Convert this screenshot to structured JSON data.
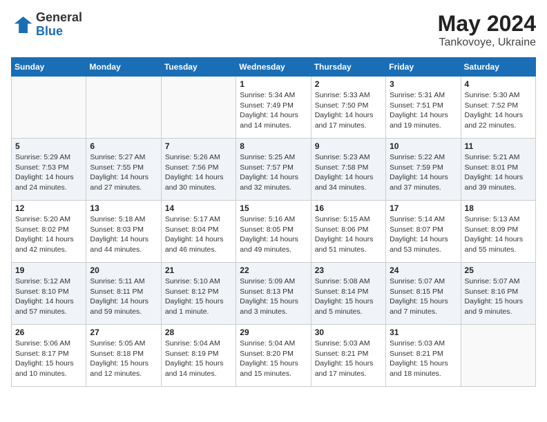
{
  "header": {
    "logo": {
      "line1": "General",
      "line2": "Blue"
    },
    "title": "May 2024",
    "location": "Tankovoye, Ukraine"
  },
  "weekdays": [
    "Sunday",
    "Monday",
    "Tuesday",
    "Wednesday",
    "Thursday",
    "Friday",
    "Saturday"
  ],
  "weeks": [
    [
      {
        "day": "",
        "info": ""
      },
      {
        "day": "",
        "info": ""
      },
      {
        "day": "",
        "info": ""
      },
      {
        "day": "1",
        "info": "Sunrise: 5:34 AM\nSunset: 7:49 PM\nDaylight: 14 hours\nand 14 minutes."
      },
      {
        "day": "2",
        "info": "Sunrise: 5:33 AM\nSunset: 7:50 PM\nDaylight: 14 hours\nand 17 minutes."
      },
      {
        "day": "3",
        "info": "Sunrise: 5:31 AM\nSunset: 7:51 PM\nDaylight: 14 hours\nand 19 minutes."
      },
      {
        "day": "4",
        "info": "Sunrise: 5:30 AM\nSunset: 7:52 PM\nDaylight: 14 hours\nand 22 minutes."
      }
    ],
    [
      {
        "day": "5",
        "info": "Sunrise: 5:29 AM\nSunset: 7:53 PM\nDaylight: 14 hours\nand 24 minutes."
      },
      {
        "day": "6",
        "info": "Sunrise: 5:27 AM\nSunset: 7:55 PM\nDaylight: 14 hours\nand 27 minutes."
      },
      {
        "day": "7",
        "info": "Sunrise: 5:26 AM\nSunset: 7:56 PM\nDaylight: 14 hours\nand 30 minutes."
      },
      {
        "day": "8",
        "info": "Sunrise: 5:25 AM\nSunset: 7:57 PM\nDaylight: 14 hours\nand 32 minutes."
      },
      {
        "day": "9",
        "info": "Sunrise: 5:23 AM\nSunset: 7:58 PM\nDaylight: 14 hours\nand 34 minutes."
      },
      {
        "day": "10",
        "info": "Sunrise: 5:22 AM\nSunset: 7:59 PM\nDaylight: 14 hours\nand 37 minutes."
      },
      {
        "day": "11",
        "info": "Sunrise: 5:21 AM\nSunset: 8:01 PM\nDaylight: 14 hours\nand 39 minutes."
      }
    ],
    [
      {
        "day": "12",
        "info": "Sunrise: 5:20 AM\nSunset: 8:02 PM\nDaylight: 14 hours\nand 42 minutes."
      },
      {
        "day": "13",
        "info": "Sunrise: 5:18 AM\nSunset: 8:03 PM\nDaylight: 14 hours\nand 44 minutes."
      },
      {
        "day": "14",
        "info": "Sunrise: 5:17 AM\nSunset: 8:04 PM\nDaylight: 14 hours\nand 46 minutes."
      },
      {
        "day": "15",
        "info": "Sunrise: 5:16 AM\nSunset: 8:05 PM\nDaylight: 14 hours\nand 49 minutes."
      },
      {
        "day": "16",
        "info": "Sunrise: 5:15 AM\nSunset: 8:06 PM\nDaylight: 14 hours\nand 51 minutes."
      },
      {
        "day": "17",
        "info": "Sunrise: 5:14 AM\nSunset: 8:07 PM\nDaylight: 14 hours\nand 53 minutes."
      },
      {
        "day": "18",
        "info": "Sunrise: 5:13 AM\nSunset: 8:09 PM\nDaylight: 14 hours\nand 55 minutes."
      }
    ],
    [
      {
        "day": "19",
        "info": "Sunrise: 5:12 AM\nSunset: 8:10 PM\nDaylight: 14 hours\nand 57 minutes."
      },
      {
        "day": "20",
        "info": "Sunrise: 5:11 AM\nSunset: 8:11 PM\nDaylight: 14 hours\nand 59 minutes."
      },
      {
        "day": "21",
        "info": "Sunrise: 5:10 AM\nSunset: 8:12 PM\nDaylight: 15 hours\nand 1 minute."
      },
      {
        "day": "22",
        "info": "Sunrise: 5:09 AM\nSunset: 8:13 PM\nDaylight: 15 hours\nand 3 minutes."
      },
      {
        "day": "23",
        "info": "Sunrise: 5:08 AM\nSunset: 8:14 PM\nDaylight: 15 hours\nand 5 minutes."
      },
      {
        "day": "24",
        "info": "Sunrise: 5:07 AM\nSunset: 8:15 PM\nDaylight: 15 hours\nand 7 minutes."
      },
      {
        "day": "25",
        "info": "Sunrise: 5:07 AM\nSunset: 8:16 PM\nDaylight: 15 hours\nand 9 minutes."
      }
    ],
    [
      {
        "day": "26",
        "info": "Sunrise: 5:06 AM\nSunset: 8:17 PM\nDaylight: 15 hours\nand 10 minutes."
      },
      {
        "day": "27",
        "info": "Sunrise: 5:05 AM\nSunset: 8:18 PM\nDaylight: 15 hours\nand 12 minutes."
      },
      {
        "day": "28",
        "info": "Sunrise: 5:04 AM\nSunset: 8:19 PM\nDaylight: 15 hours\nand 14 minutes."
      },
      {
        "day": "29",
        "info": "Sunrise: 5:04 AM\nSunset: 8:20 PM\nDaylight: 15 hours\nand 15 minutes."
      },
      {
        "day": "30",
        "info": "Sunrise: 5:03 AM\nSunset: 8:21 PM\nDaylight: 15 hours\nand 17 minutes."
      },
      {
        "day": "31",
        "info": "Sunrise: 5:03 AM\nSunset: 8:21 PM\nDaylight: 15 hours\nand 18 minutes."
      },
      {
        "day": "",
        "info": ""
      }
    ]
  ]
}
